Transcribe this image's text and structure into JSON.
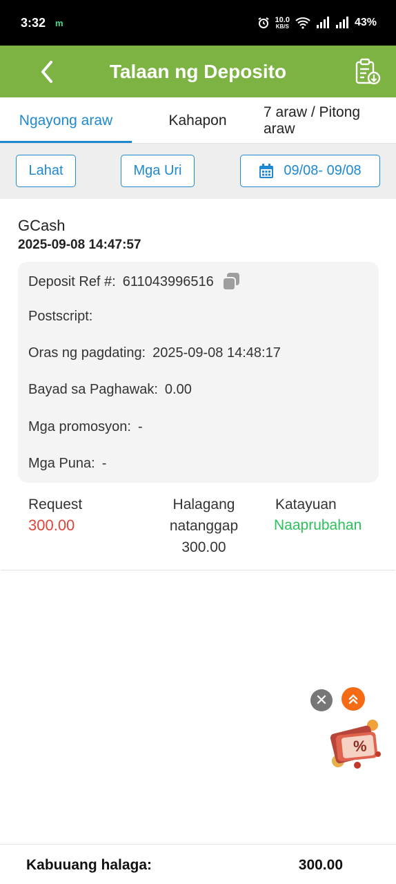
{
  "status_bar": {
    "time": "3:32",
    "app_icon": "m",
    "net_speed_value": "10.0",
    "net_speed_unit": "KB/S",
    "battery": "43%"
  },
  "header": {
    "title": "Talaan ng Deposito",
    "back_icon": "chevron-left-icon",
    "report_icon": "clipboard-download-icon",
    "bg_color": "#7cb342"
  },
  "tabs": [
    {
      "label": "Ngayong araw",
      "active": true
    },
    {
      "label": "Kahapon",
      "active": false
    },
    {
      "label": "7 araw / Pitong araw",
      "active": false
    }
  ],
  "filters": {
    "all_label": "Lahat",
    "types_label": "Mga Uri",
    "date_range": "09/08- 09/08",
    "accent_color": "#1e88d0"
  },
  "record": {
    "method": "GCash",
    "datetime": "2025-09-08 14:47:57",
    "details": [
      {
        "label": "Deposit Ref #:",
        "value": "611043996516"
      },
      {
        "label": "Postscript:",
        "value": ""
      },
      {
        "label": "Oras ng pagdating:",
        "value": "2025-09-08 14:48:17"
      },
      {
        "label": "Bayad sa Paghawak:",
        "value": "0.00"
      },
      {
        "label": "Mga promosyon:",
        "value": "-"
      },
      {
        "label": "Mga Puna:",
        "value": "-"
      }
    ],
    "request_label": "Request",
    "request_value": "300.00",
    "received_label_1": "Halagang",
    "received_label_2": "natanggap",
    "received_value": "300.00",
    "status_label": "Katayuan",
    "status_value": "Naaprubahan",
    "request_color": "#e0443a",
    "status_color": "#2cc05a"
  },
  "float": {
    "close_icon": "close-icon",
    "up_icon": "double-chevron-up-icon",
    "promo_icon": "discount-gift-icon"
  },
  "total": {
    "label": "Kabuuang halaga:",
    "value": "300.00"
  }
}
